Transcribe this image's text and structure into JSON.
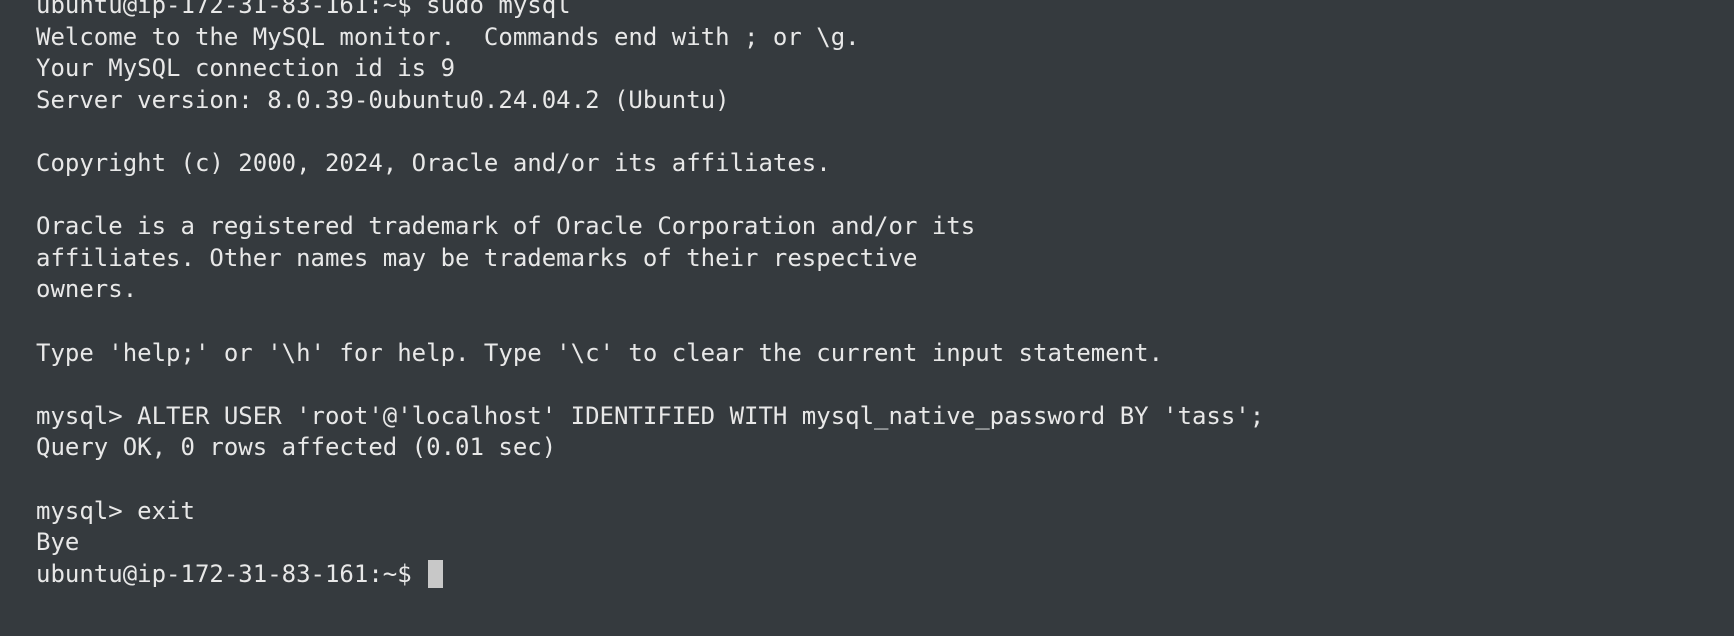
{
  "terminal": {
    "lines": [
      "ubuntu@ip-172-31-83-161:~$ sudo mysql",
      "Welcome to the MySQL monitor.  Commands end with ; or \\g.",
      "Your MySQL connection id is 9",
      "Server version: 8.0.39-0ubuntu0.24.04.2 (Ubuntu)",
      "",
      "Copyright (c) 2000, 2024, Oracle and/or its affiliates.",
      "",
      "Oracle is a registered trademark of Oracle Corporation and/or its",
      "affiliates. Other names may be trademarks of their respective",
      "owners.",
      "",
      "Type 'help;' or '\\h' for help. Type '\\c' to clear the current input statement.",
      "",
      "mysql> ALTER USER 'root'@'localhost' IDENTIFIED WITH mysql_native_password BY 'tass';",
      "Query OK, 0 rows affected (0.01 sec)",
      "",
      "mysql> exit",
      "Bye"
    ],
    "prompt": "ubuntu@ip-172-31-83-161:~$ ",
    "colors": {
      "background": "#353a3e",
      "foreground": "#e8e8e8",
      "cursor": "#c8c8c8"
    }
  }
}
